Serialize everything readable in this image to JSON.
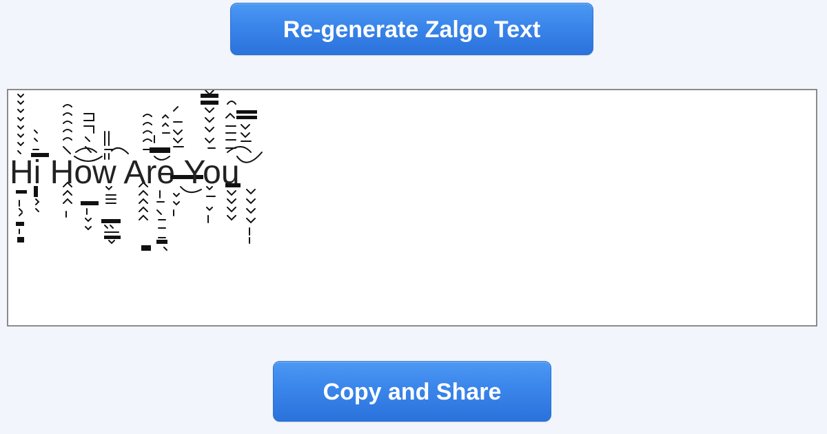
{
  "buttons": {
    "regenerate_label": "Re-generate Zalgo Text",
    "copy_label": "Copy and Share"
  },
  "output": {
    "text": "Hi How Are You"
  },
  "colors": {
    "page_background": "#f2f6fc",
    "button_top": "#4c98f3",
    "button_bottom": "#2b72dc",
    "button_text": "#ffffff",
    "output_border": "#8a8a8a"
  }
}
